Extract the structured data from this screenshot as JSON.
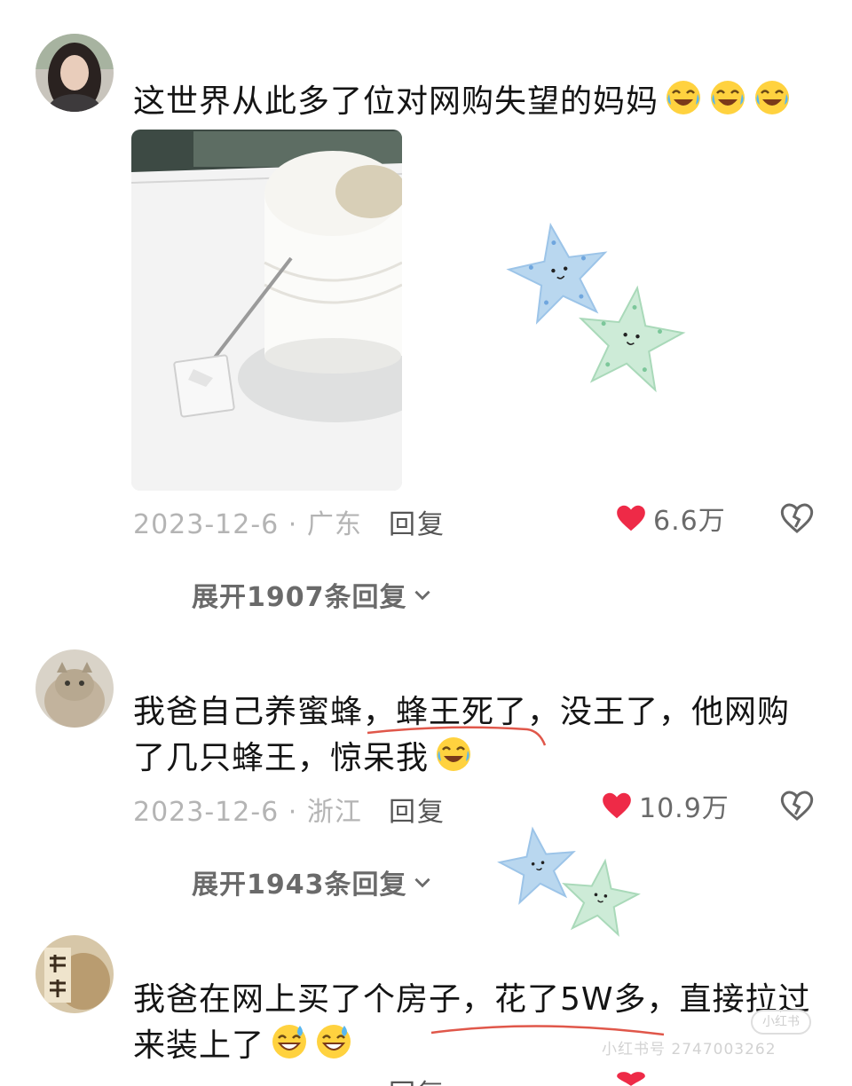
{
  "comments": [
    {
      "text": "这世界从此多了位对网购失望的妈妈",
      "emoji_name": "laugh-cry-emoji",
      "emoji_count": 3,
      "date_location": "2023-12-6 · 广东",
      "reply_label": "回复",
      "likes": "6.6万",
      "expand_label": "展开1907条回复"
    },
    {
      "text_line1": "我爸自己养蜜蜂，蜂王死了，没王了，他网购",
      "text_line2": "了几只蜂王，惊呆我",
      "emoji_name": "laugh-cry-emoji",
      "date_location": "2023-12-6 · 浙江",
      "reply_label": "回复",
      "likes": "10.9万",
      "expand_label": "展开1943条回复"
    },
    {
      "text_line1": "我爸在网上买了个房子，花了5W多，直接拉过",
      "text_line2": "来装上了",
      "emoji_name": "sweat-smile-emoji",
      "reply_label": "回复"
    }
  ],
  "watermark": "小红书号 2747003262",
  "watermark_logo": "小红书",
  "colors": {
    "like_heart": "#ee2a47",
    "meta_text": "#b4b4b4",
    "underline": "#e0574a"
  }
}
